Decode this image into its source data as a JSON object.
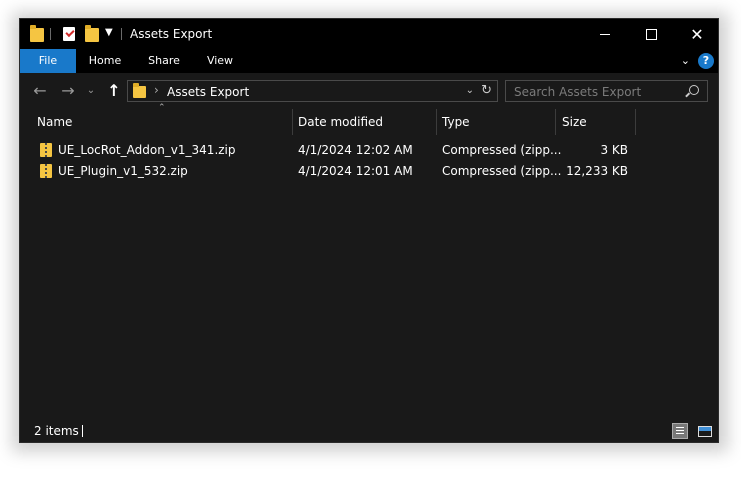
{
  "window": {
    "title": "Assets Export"
  },
  "ribbon": {
    "tabs": [
      {
        "label": "File"
      },
      {
        "label": "Home"
      },
      {
        "label": "Share"
      },
      {
        "label": "View"
      }
    ],
    "help_label": "?"
  },
  "navigation": {
    "back_icon": "arrow-left-icon",
    "forward_icon": "arrow-right-icon",
    "recent_icon": "chevron-down-icon",
    "up_icon": "arrow-up-icon",
    "path": "Assets Export",
    "search_placeholder": "Search Assets Export"
  },
  "columns": [
    {
      "label": "Name"
    },
    {
      "label": "Date modified"
    },
    {
      "label": "Type"
    },
    {
      "label": "Size"
    }
  ],
  "files": [
    {
      "name": "UE_LocRot_Addon_v1_341.zip",
      "date": "4/1/2024 12:02 AM",
      "type": "Compressed (zipp...",
      "size": "3 KB"
    },
    {
      "name": "UE_Plugin_v1_532.zip",
      "date": "4/1/2024 12:01 AM",
      "type": "Compressed (zipp...",
      "size": "12,233 KB"
    }
  ],
  "status": {
    "items": "2 items"
  },
  "colors": {
    "accent": "#1979ca",
    "background": "#191919",
    "titlebar": "#000000",
    "folder": "#f5c542"
  }
}
